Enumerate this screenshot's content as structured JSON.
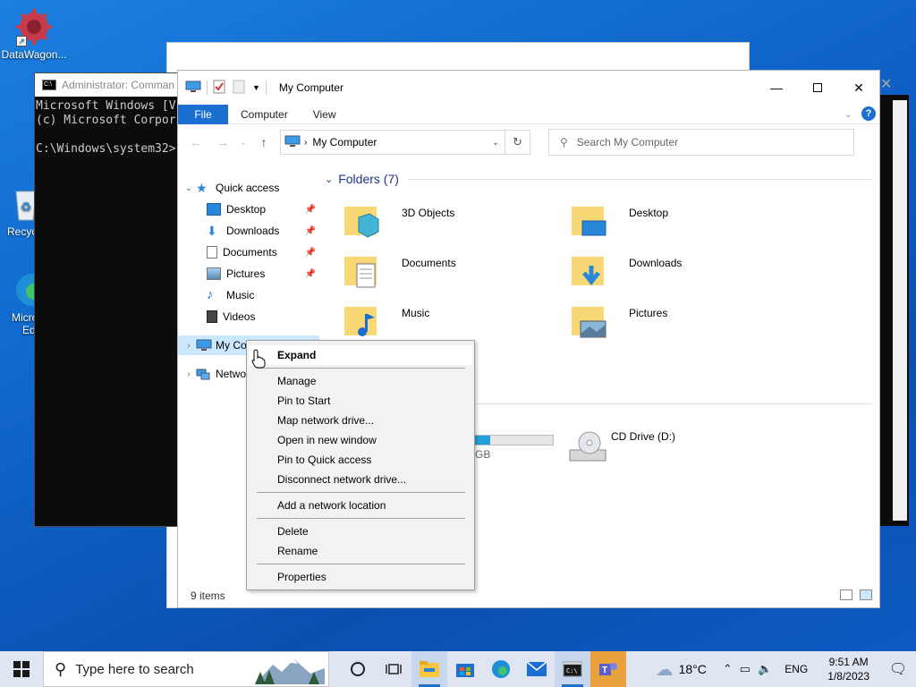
{
  "desktop": {
    "icons": [
      {
        "label": "DataWagon..."
      },
      {
        "label": "Recyc"
      },
      {
        "label": "Micro"
      },
      {
        "label": "Ed"
      }
    ]
  },
  "cmd": {
    "title": "Administrator: Comman",
    "lines": [
      "Microsoft Windows [V",
      "(c) Microsoft Corpor",
      "",
      "C:\\Windows\\system32>"
    ]
  },
  "explorer": {
    "title": "My Computer",
    "ribbon_tabs": [
      "File",
      "Computer",
      "View"
    ],
    "address": "My Computer",
    "search_placeholder": "Search My Computer",
    "nav": {
      "quick_access": "Quick access",
      "items": [
        "Desktop",
        "Downloads",
        "Documents",
        "Pictures",
        "Music",
        "Videos"
      ],
      "my_computer": "My Co",
      "network": "Netwo"
    },
    "folders_header": "Folders (7)",
    "folders": [
      "3D Objects",
      "Desktop",
      "Documents",
      "Downloads",
      "Music",
      "Pictures"
    ],
    "drive_fragment": "GB",
    "cd_drive": "CD Drive (D:)",
    "drive_usage_fraction": 0.2,
    "status": "9 items"
  },
  "context_menu": {
    "items": [
      "Expand",
      "Manage",
      "Pin to Start",
      "Map network drive...",
      "Open in new window",
      "Pin to Quick access",
      "Disconnect network drive...",
      "Add a network location",
      "Delete",
      "Rename",
      "Properties"
    ]
  },
  "taskbar": {
    "search_placeholder": "Type here to search",
    "weather": "18°C",
    "language": "ENG",
    "time": "9:51 AM",
    "date": "1/8/2023"
  },
  "colors": {
    "accent": "#1a6fd1",
    "folder": "#f8d775"
  }
}
